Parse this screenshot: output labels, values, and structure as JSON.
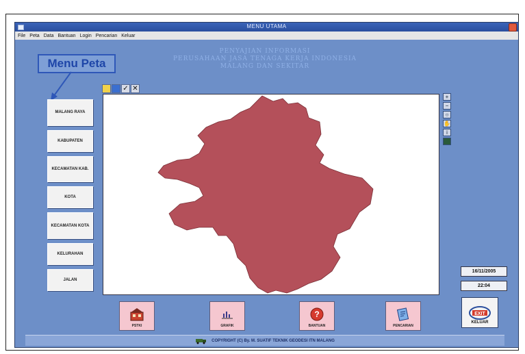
{
  "window": {
    "title": "MENU UTAMA"
  },
  "menubar": [
    "File",
    "Peta",
    "Data",
    "Bantuan",
    "Login",
    "Pencarian",
    "Keluar"
  ],
  "header": {
    "line1": "PENYAJIAN INFORMASI",
    "line2": "PERUSAHAAN JASA TENAGA KERJA INDONESIA",
    "line3": "MALANG DAN SEKITAR"
  },
  "annotation": {
    "label": "Menu Peta"
  },
  "left_menu": [
    {
      "label": "MALANG RAYA"
    },
    {
      "label": "KABUPATEN"
    },
    {
      "label": "KECAMATAN KAB."
    },
    {
      "label": "KOTA"
    },
    {
      "label": "KECAMATAN KOTA"
    },
    {
      "label": "KELURAHAN"
    },
    {
      "label": "JALAN"
    }
  ],
  "map_toolbar": [
    "folder-icon",
    "save-icon",
    "check-icon",
    "close-icon"
  ],
  "map_toolbar_glyphs": {
    "check": "✓",
    "close": "✕"
  },
  "right_tools": [
    "zoom-in-icon",
    "zoom-out-icon",
    "search-icon",
    "pan-hand-icon",
    "info-icon",
    "layer-icon"
  ],
  "status": {
    "date": "16/11/2005",
    "time": "22:04"
  },
  "bottom_buttons": [
    {
      "label": "PSTKI",
      "icon": "building-icon"
    },
    {
      "label": "GRAFIK",
      "icon": "chart-icon"
    },
    {
      "label": "BANTUAN",
      "icon": "help-icon"
    },
    {
      "label": "PENCARIAN",
      "icon": "search-document-icon"
    }
  ],
  "exit": {
    "label": "KELUAR",
    "badge": "EXIT"
  },
  "footer": {
    "text": "COPYRIGHT (C) By. M. SUATIF TEKNIK GEODESI ITN MALANG"
  },
  "colors": {
    "background": "#6d8fc8",
    "map_region": "#b4505a",
    "accent": "#2e57b8"
  }
}
